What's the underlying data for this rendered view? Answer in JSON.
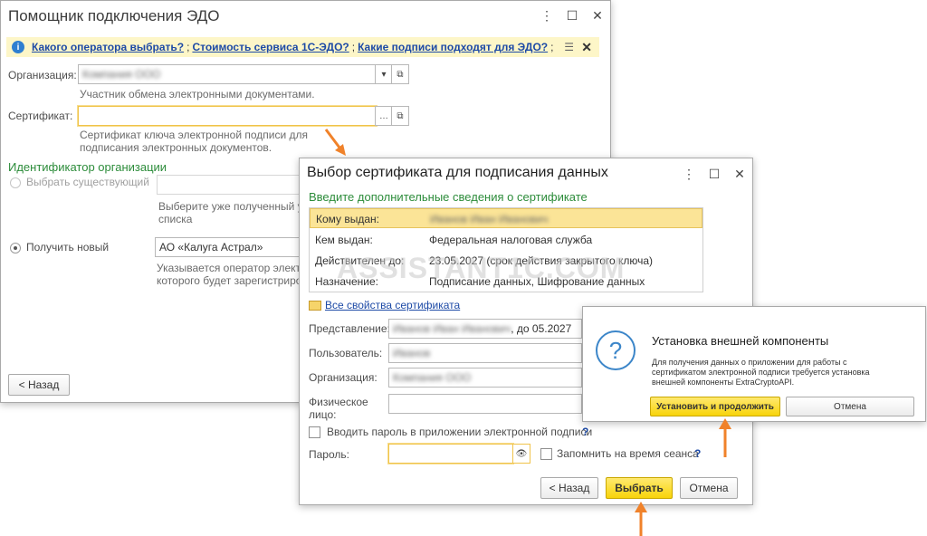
{
  "edo": {
    "title": "Помощник подключения ЭДО",
    "links": [
      "Какого оператора выбрать?",
      "Стоимость сервиса 1С-ЭДО?",
      "Какие подписи подходят для ЭДО?"
    ],
    "org_label": "Организация:",
    "org_value": "Компания ООО",
    "org_hint": "Участник обмена электронными документами.",
    "cert_label": "Сертификат:",
    "cert_hint": "Сертификат ключа электронной подписи для подписания электронных документов.",
    "id_section": "Идентификатор организации",
    "radio_existing": "Выбрать существующий",
    "existing_hint": "Выберите уже полученный у\nсписка",
    "radio_new": "Получить новый",
    "operator_value": "АО «Калуга Астрал»",
    "operator_hint": "Указывается оператор электр\nкоторого будет зарегистриро",
    "back_button": "< Назад"
  },
  "cert": {
    "title": "Выбор сертификата для подписания данных",
    "subtitle": "Введите дополнительные сведения о сертификате",
    "rows": [
      {
        "label": "Кому выдан:",
        "value": "Иванов Иван Иванович"
      },
      {
        "label": "Кем выдан:",
        "value": "Федеральная налоговая служба"
      },
      {
        "label": "Действителен до:",
        "value": "23.05.2027 (срок действия закрытого ключа)"
      },
      {
        "label": "Назначение:",
        "value": "Подписание данных, Шифрование данных"
      }
    ],
    "all_props_link": "Все свойства сертификата",
    "repr_label": "Представление:",
    "repr_blurred": "Иванов Иван Иванович",
    "repr_suffix": ", до 05.2027",
    "user_label": "Пользователь:",
    "user_value": "Иванов",
    "org_label": "Организация:",
    "org_value": "Компания ООО",
    "phys_label": "Физическое лицо:",
    "enter_password_check": "Вводить пароль в приложении электронной подписи",
    "password_label": "Пароль:",
    "remember_check": "Запомнить на время сеанса",
    "question_mark": "?",
    "back_button": "< Назад",
    "select_button": "Выбрать",
    "cancel_button": "Отмена"
  },
  "ext": {
    "title": "Установка внешней компоненты",
    "description": "Для получения данных о приложении для работы с сертификатом электронной подписи требуется установка внешней компоненты ExtraCryptoAPI.",
    "install_button": "Установить и продолжить",
    "cancel_button": "Отмена"
  },
  "watermark": "ASSISTANT1C.COM",
  "colors": {
    "accent_yellow": "#f8d40a",
    "link_blue": "#1d4aa6",
    "section_green": "#2c8c3a",
    "arrow_orange": "#f0822a"
  }
}
